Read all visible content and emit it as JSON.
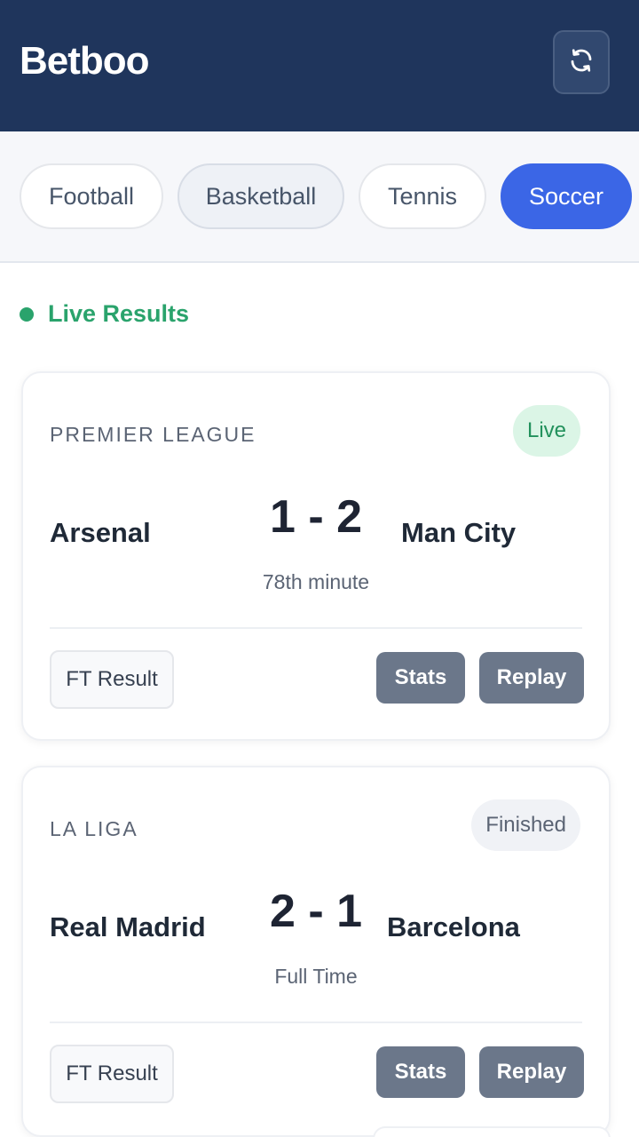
{
  "header": {
    "brand": "Betboo",
    "refresh_icon": "refresh-icon"
  },
  "tabs": [
    {
      "label": "Football"
    },
    {
      "label": "Basketball"
    },
    {
      "label": "Tennis"
    },
    {
      "label": "Soccer",
      "active": true
    }
  ],
  "section": {
    "title": "Live Results",
    "indicator_color": "#2aa36c"
  },
  "matches": [
    {
      "league": "PREMIER LEAGUE",
      "status": "Live",
      "home": "Arsenal",
      "away": "Man City",
      "score": "1 - 2",
      "time": "78th minute",
      "ft_label": "FT Result",
      "stats_label": "Stats",
      "replay_label": "Replay"
    },
    {
      "league": "LA LIGA",
      "status": "Finished",
      "home": "Real Madrid",
      "away": "Barcelona",
      "score": "2 - 1",
      "time": "Full Time",
      "ft_label": "FT Result",
      "stats_label": "Stats",
      "replay_label": "Replay"
    }
  ],
  "colors": {
    "header_bg": "#1f355c",
    "accent": "#3b66e6",
    "live": "#22915c",
    "button": "#6b778a"
  }
}
